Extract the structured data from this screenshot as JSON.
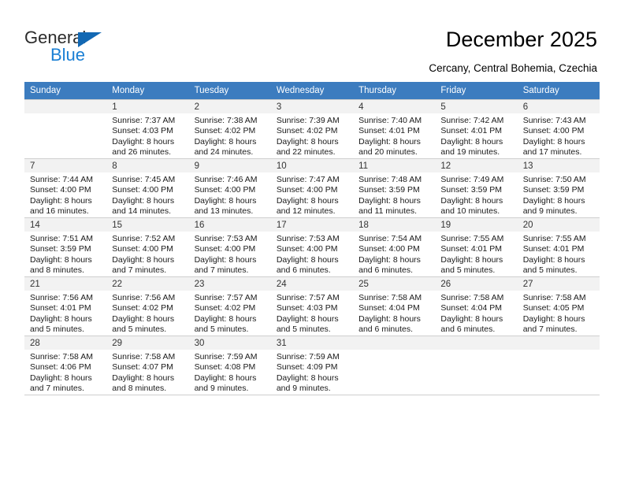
{
  "brand": {
    "name_top": "General",
    "name_bottom": "Blue",
    "accent_color": "#1a7fd4",
    "triangle_color": "#1268b3"
  },
  "header": {
    "title": "December 2025",
    "subtitle": "Cercany, Central Bohemia, Czechia"
  },
  "calendar": {
    "header_bg": "#3c7cbf",
    "daynum_bg": "#f2f2f2",
    "weekdays": [
      "Sunday",
      "Monday",
      "Tuesday",
      "Wednesday",
      "Thursday",
      "Friday",
      "Saturday"
    ],
    "weeks": [
      [
        {
          "day": ""
        },
        {
          "day": "1",
          "sunrise": "Sunrise: 7:37 AM",
          "sunset": "Sunset: 4:03 PM",
          "daylight_line1": "Daylight: 8 hours",
          "daylight_line2": "and 26 minutes."
        },
        {
          "day": "2",
          "sunrise": "Sunrise: 7:38 AM",
          "sunset": "Sunset: 4:02 PM",
          "daylight_line1": "Daylight: 8 hours",
          "daylight_line2": "and 24 minutes."
        },
        {
          "day": "3",
          "sunrise": "Sunrise: 7:39 AM",
          "sunset": "Sunset: 4:02 PM",
          "daylight_line1": "Daylight: 8 hours",
          "daylight_line2": "and 22 minutes."
        },
        {
          "day": "4",
          "sunrise": "Sunrise: 7:40 AM",
          "sunset": "Sunset: 4:01 PM",
          "daylight_line1": "Daylight: 8 hours",
          "daylight_line2": "and 20 minutes."
        },
        {
          "day": "5",
          "sunrise": "Sunrise: 7:42 AM",
          "sunset": "Sunset: 4:01 PM",
          "daylight_line1": "Daylight: 8 hours",
          "daylight_line2": "and 19 minutes."
        },
        {
          "day": "6",
          "sunrise": "Sunrise: 7:43 AM",
          "sunset": "Sunset: 4:00 PM",
          "daylight_line1": "Daylight: 8 hours",
          "daylight_line2": "and 17 minutes."
        }
      ],
      [
        {
          "day": "7",
          "sunrise": "Sunrise: 7:44 AM",
          "sunset": "Sunset: 4:00 PM",
          "daylight_line1": "Daylight: 8 hours",
          "daylight_line2": "and 16 minutes."
        },
        {
          "day": "8",
          "sunrise": "Sunrise: 7:45 AM",
          "sunset": "Sunset: 4:00 PM",
          "daylight_line1": "Daylight: 8 hours",
          "daylight_line2": "and 14 minutes."
        },
        {
          "day": "9",
          "sunrise": "Sunrise: 7:46 AM",
          "sunset": "Sunset: 4:00 PM",
          "daylight_line1": "Daylight: 8 hours",
          "daylight_line2": "and 13 minutes."
        },
        {
          "day": "10",
          "sunrise": "Sunrise: 7:47 AM",
          "sunset": "Sunset: 4:00 PM",
          "daylight_line1": "Daylight: 8 hours",
          "daylight_line2": "and 12 minutes."
        },
        {
          "day": "11",
          "sunrise": "Sunrise: 7:48 AM",
          "sunset": "Sunset: 3:59 PM",
          "daylight_line1": "Daylight: 8 hours",
          "daylight_line2": "and 11 minutes."
        },
        {
          "day": "12",
          "sunrise": "Sunrise: 7:49 AM",
          "sunset": "Sunset: 3:59 PM",
          "daylight_line1": "Daylight: 8 hours",
          "daylight_line2": "and 10 minutes."
        },
        {
          "day": "13",
          "sunrise": "Sunrise: 7:50 AM",
          "sunset": "Sunset: 3:59 PM",
          "daylight_line1": "Daylight: 8 hours",
          "daylight_line2": "and 9 minutes."
        }
      ],
      [
        {
          "day": "14",
          "sunrise": "Sunrise: 7:51 AM",
          "sunset": "Sunset: 3:59 PM",
          "daylight_line1": "Daylight: 8 hours",
          "daylight_line2": "and 8 minutes."
        },
        {
          "day": "15",
          "sunrise": "Sunrise: 7:52 AM",
          "sunset": "Sunset: 4:00 PM",
          "daylight_line1": "Daylight: 8 hours",
          "daylight_line2": "and 7 minutes."
        },
        {
          "day": "16",
          "sunrise": "Sunrise: 7:53 AM",
          "sunset": "Sunset: 4:00 PM",
          "daylight_line1": "Daylight: 8 hours",
          "daylight_line2": "and 7 minutes."
        },
        {
          "day": "17",
          "sunrise": "Sunrise: 7:53 AM",
          "sunset": "Sunset: 4:00 PM",
          "daylight_line1": "Daylight: 8 hours",
          "daylight_line2": "and 6 minutes."
        },
        {
          "day": "18",
          "sunrise": "Sunrise: 7:54 AM",
          "sunset": "Sunset: 4:00 PM",
          "daylight_line1": "Daylight: 8 hours",
          "daylight_line2": "and 6 minutes."
        },
        {
          "day": "19",
          "sunrise": "Sunrise: 7:55 AM",
          "sunset": "Sunset: 4:01 PM",
          "daylight_line1": "Daylight: 8 hours",
          "daylight_line2": "and 5 minutes."
        },
        {
          "day": "20",
          "sunrise": "Sunrise: 7:55 AM",
          "sunset": "Sunset: 4:01 PM",
          "daylight_line1": "Daylight: 8 hours",
          "daylight_line2": "and 5 minutes."
        }
      ],
      [
        {
          "day": "21",
          "sunrise": "Sunrise: 7:56 AM",
          "sunset": "Sunset: 4:01 PM",
          "daylight_line1": "Daylight: 8 hours",
          "daylight_line2": "and 5 minutes."
        },
        {
          "day": "22",
          "sunrise": "Sunrise: 7:56 AM",
          "sunset": "Sunset: 4:02 PM",
          "daylight_line1": "Daylight: 8 hours",
          "daylight_line2": "and 5 minutes."
        },
        {
          "day": "23",
          "sunrise": "Sunrise: 7:57 AM",
          "sunset": "Sunset: 4:02 PM",
          "daylight_line1": "Daylight: 8 hours",
          "daylight_line2": "and 5 minutes."
        },
        {
          "day": "24",
          "sunrise": "Sunrise: 7:57 AM",
          "sunset": "Sunset: 4:03 PM",
          "daylight_line1": "Daylight: 8 hours",
          "daylight_line2": "and 5 minutes."
        },
        {
          "day": "25",
          "sunrise": "Sunrise: 7:58 AM",
          "sunset": "Sunset: 4:04 PM",
          "daylight_line1": "Daylight: 8 hours",
          "daylight_line2": "and 6 minutes."
        },
        {
          "day": "26",
          "sunrise": "Sunrise: 7:58 AM",
          "sunset": "Sunset: 4:04 PM",
          "daylight_line1": "Daylight: 8 hours",
          "daylight_line2": "and 6 minutes."
        },
        {
          "day": "27",
          "sunrise": "Sunrise: 7:58 AM",
          "sunset": "Sunset: 4:05 PM",
          "daylight_line1": "Daylight: 8 hours",
          "daylight_line2": "and 7 minutes."
        }
      ],
      [
        {
          "day": "28",
          "sunrise": "Sunrise: 7:58 AM",
          "sunset": "Sunset: 4:06 PM",
          "daylight_line1": "Daylight: 8 hours",
          "daylight_line2": "and 7 minutes."
        },
        {
          "day": "29",
          "sunrise": "Sunrise: 7:58 AM",
          "sunset": "Sunset: 4:07 PM",
          "daylight_line1": "Daylight: 8 hours",
          "daylight_line2": "and 8 minutes."
        },
        {
          "day": "30",
          "sunrise": "Sunrise: 7:59 AM",
          "sunset": "Sunset: 4:08 PM",
          "daylight_line1": "Daylight: 8 hours",
          "daylight_line2": "and 9 minutes."
        },
        {
          "day": "31",
          "sunrise": "Sunrise: 7:59 AM",
          "sunset": "Sunset: 4:09 PM",
          "daylight_line1": "Daylight: 8 hours",
          "daylight_line2": "and 9 minutes."
        },
        {
          "day": ""
        },
        {
          "day": ""
        },
        {
          "day": ""
        }
      ]
    ]
  }
}
